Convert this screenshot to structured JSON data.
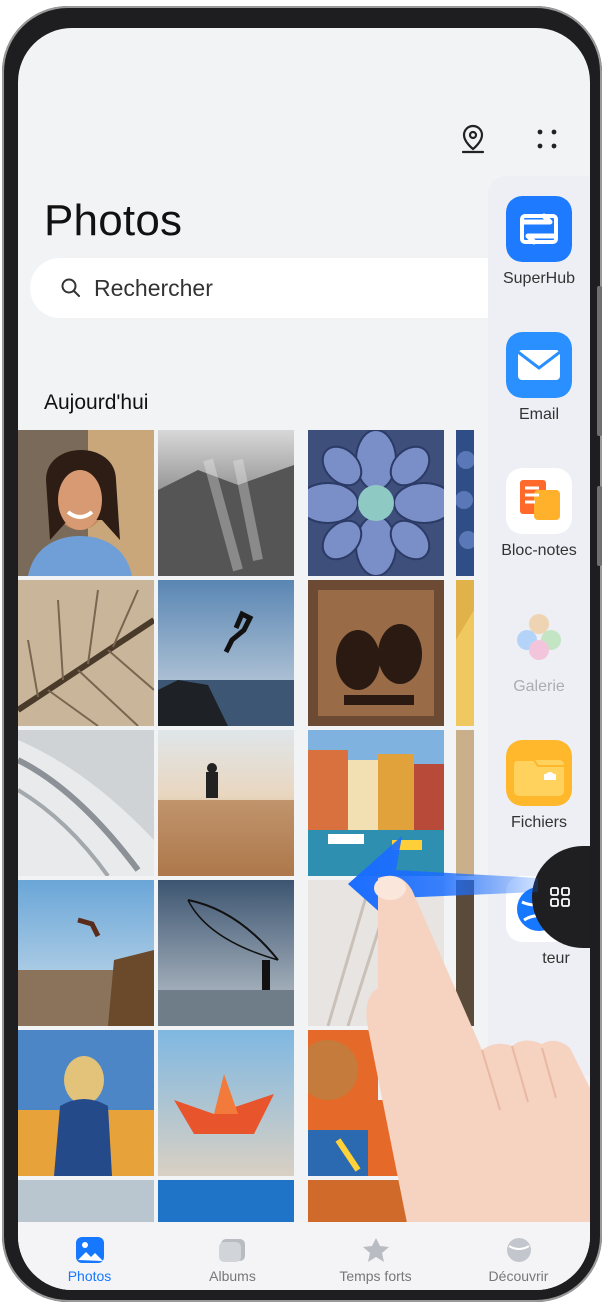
{
  "header": {
    "title": "Photos",
    "map_icon": "location-pin-icon",
    "more_icon": "more-grid-icon"
  },
  "search": {
    "placeholder": "Rechercher",
    "icon": "search-icon"
  },
  "section_title": "Aujourd'hui",
  "dock": {
    "items": [
      {
        "label": "SuperHub",
        "icon": "superhub-icon",
        "color": "#1e7bff"
      },
      {
        "label": "Email",
        "icon": "email-icon",
        "color": "#1e90ff"
      },
      {
        "label": "Bloc-notes",
        "icon": "notepad-icon",
        "color": "#ff7a2e"
      },
      {
        "label": "Galerie",
        "icon": "gallery-icon",
        "color": "#f2a33b"
      },
      {
        "label": "Fichiers",
        "icon": "files-icon",
        "color": "#ffb72b"
      },
      {
        "label": "Navigateur",
        "icon": "browser-icon",
        "color": "#1677ff"
      }
    ],
    "dock_visible_last_label": "teur"
  },
  "tabbar": {
    "tabs": [
      {
        "label": "Photos",
        "icon": "photos-icon",
        "active": true
      },
      {
        "label": "Albums",
        "icon": "albums-icon",
        "active": false
      },
      {
        "label": "Temps forts",
        "icon": "star-icon",
        "active": false
      },
      {
        "label": "Découvrir",
        "icon": "discover-icon",
        "active": false
      }
    ]
  },
  "colors": {
    "accent": "#1677ff",
    "background": "#f1f3f5",
    "gesture_arrow": "#1a6dff"
  }
}
